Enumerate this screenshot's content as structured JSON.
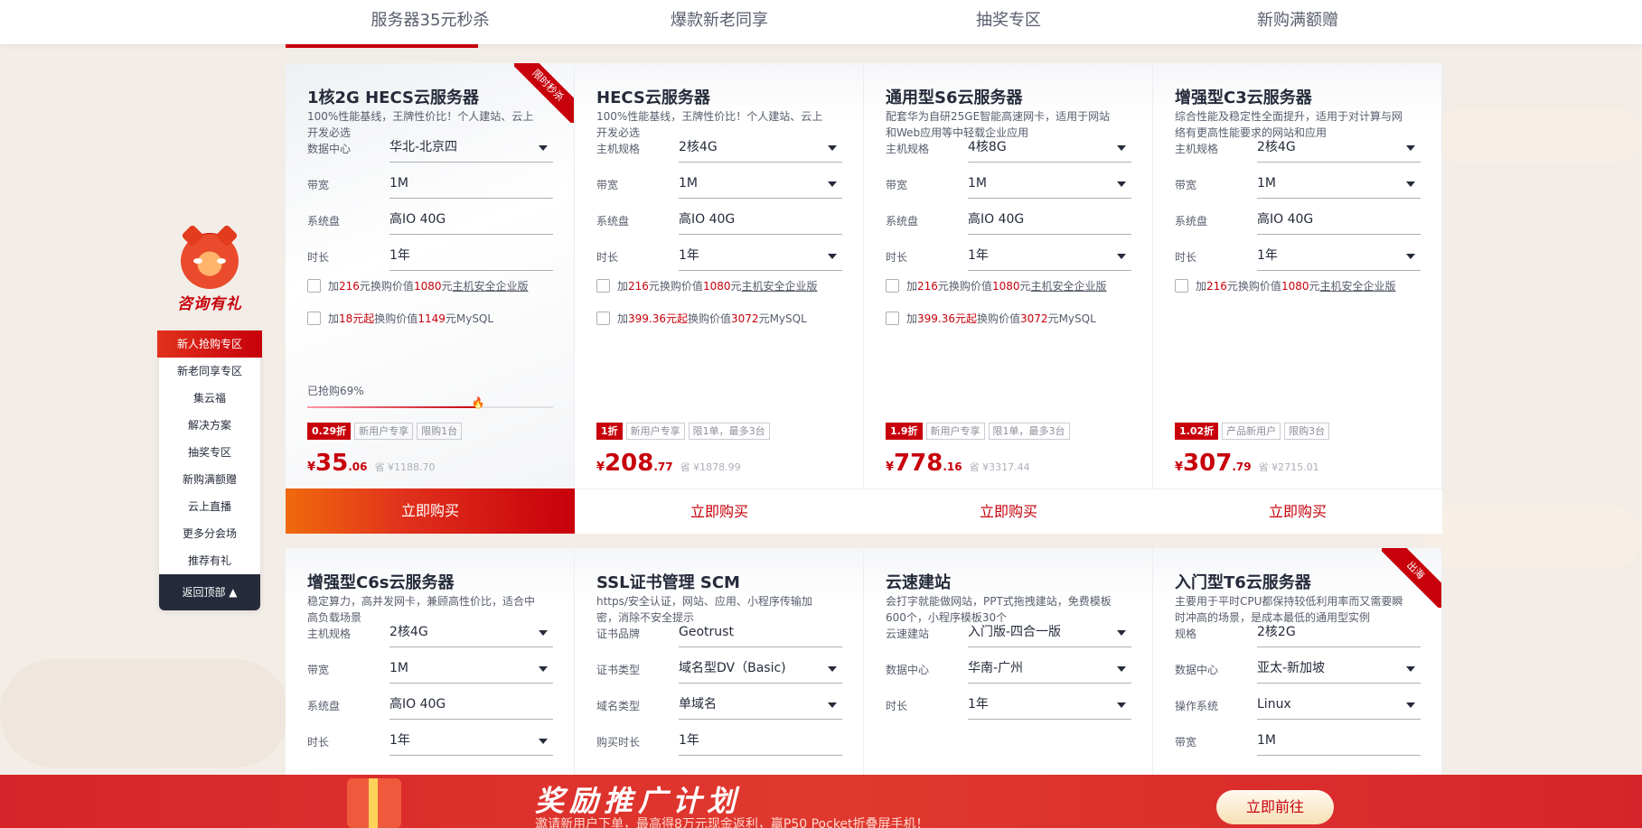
{
  "tabs": [
    "服务器35元秒杀",
    "爆款新老同享",
    "抽奖专区",
    "新购满额赠"
  ],
  "side": {
    "mascot_title": "咨询有礼",
    "items": [
      "新人抢购专区",
      "新老同享专区",
      "集云福",
      "解决方案",
      "抽奖专区",
      "新购满额赠",
      "云上直播",
      "更多分会场",
      "推荐有礼"
    ],
    "back_top": "返回顶部"
  },
  "cards_row1": [
    {
      "ribbon": "限时秒杀",
      "title": "1核2G HECS云服务器",
      "desc": "100%性能基线，王牌性价比！个人建站、云上开发必选",
      "fields": [
        {
          "label": "数据中心",
          "value": "华北-北京四",
          "dropdown": true
        },
        {
          "label": "带宽",
          "value": "1M",
          "dropdown": false
        },
        {
          "label": "系统盘",
          "value": "高IO 40G",
          "dropdown": false
        },
        {
          "label": "时长",
          "value": "1年",
          "dropdown": false
        }
      ],
      "addons": [
        {
          "pre": "加",
          "amt": "216",
          "mid": "元换购价值",
          "val": "1080",
          "post": "元",
          "link": "主机安全企业版"
        },
        {
          "pre": "加",
          "amt": "18元起",
          "mid": "换购价值",
          "val": "1149",
          "post": "元MySQL",
          "link": ""
        }
      ],
      "sold": "已抢购69%",
      "sold_pct": 69,
      "discount": "0.29折",
      "tags": [
        "新用户专享",
        "限购1台"
      ],
      "price_int": "35",
      "price_dec": ".06",
      "orig": "省 ¥1188.70",
      "buy": "立即购买"
    },
    {
      "ribbon": "",
      "title": "HECS云服务器",
      "desc": "100%性能基线，王牌性价比！个人建站、云上开发必选",
      "fields": [
        {
          "label": "主机规格",
          "value": "2核4G",
          "dropdown": true
        },
        {
          "label": "带宽",
          "value": "1M",
          "dropdown": true
        },
        {
          "label": "系统盘",
          "value": "高IO 40G",
          "dropdown": false
        },
        {
          "label": "时长",
          "value": "1年",
          "dropdown": true
        }
      ],
      "addons": [
        {
          "pre": "加",
          "amt": "216",
          "mid": "元换购价值",
          "val": "1080",
          "post": "元",
          "link": "主机安全企业版"
        },
        {
          "pre": "加",
          "amt": "399.36元起",
          "mid": "换购价值",
          "val": "3072",
          "post": "元MySQL",
          "link": ""
        }
      ],
      "discount": "1折",
      "tags": [
        "新用户专享",
        "限1单，最多3台"
      ],
      "price_int": "208",
      "price_dec": ".77",
      "orig": "省 ¥1878.99",
      "buy": "立即购买"
    },
    {
      "ribbon": "",
      "title": "通用型S6云服务器",
      "desc": "配套华为自研25GE智能高速网卡，适用于网站和Web应用等中轻载企业应用",
      "fields": [
        {
          "label": "主机规格",
          "value": "4核8G",
          "dropdown": true
        },
        {
          "label": "带宽",
          "value": "1M",
          "dropdown": true
        },
        {
          "label": "系统盘",
          "value": "高IO 40G",
          "dropdown": false
        },
        {
          "label": "时长",
          "value": "1年",
          "dropdown": true
        }
      ],
      "addons": [
        {
          "pre": "加",
          "amt": "216",
          "mid": "元换购价值",
          "val": "1080",
          "post": "元",
          "link": "主机安全企业版"
        },
        {
          "pre": "加",
          "amt": "399.36元起",
          "mid": "换购价值",
          "val": "3072",
          "post": "元MySQL",
          "link": ""
        }
      ],
      "discount": "1.9折",
      "tags": [
        "新用户专享",
        "限1单，最多3台"
      ],
      "price_int": "778",
      "price_dec": ".16",
      "orig": "省 ¥3317.44",
      "buy": "立即购买"
    },
    {
      "ribbon": "",
      "title": "增强型C3云服务器",
      "desc": "综合性能及稳定性全面提升，适用于对计算与网络有更高性能要求的网站和应用",
      "fields": [
        {
          "label": "主机规格",
          "value": "2核4G",
          "dropdown": true
        },
        {
          "label": "带宽",
          "value": "1M",
          "dropdown": true
        },
        {
          "label": "系统盘",
          "value": "高IO 40G",
          "dropdown": false
        },
        {
          "label": "时长",
          "value": "1年",
          "dropdown": true
        }
      ],
      "addons": [
        {
          "pre": "加",
          "amt": "216",
          "mid": "元换购价值",
          "val": "1080",
          "post": "元",
          "link": "主机安全企业版"
        }
      ],
      "discount": "1.02折",
      "tags": [
        "产品新用户",
        "限购3台"
      ],
      "price_int": "307",
      "price_dec": ".79",
      "orig": "省 ¥2715.01",
      "buy": "立即购买"
    }
  ],
  "cards_row2": [
    {
      "ribbon": "",
      "title": "增强型C6s云服务器",
      "desc": "稳定算力，高并发网卡，兼顾高性价比，适合中高负载场景",
      "fields": [
        {
          "label": "主机规格",
          "value": "2核4G",
          "dropdown": true
        },
        {
          "label": "带宽",
          "value": "1M",
          "dropdown": true
        },
        {
          "label": "系统盘",
          "value": "高IO 40G",
          "dropdown": false
        },
        {
          "label": "时长",
          "value": "1年",
          "dropdown": true
        }
      ]
    },
    {
      "ribbon": "",
      "title": "SSL证书管理 SCM",
      "desc": "https/安全认证，网站、应用、小程序传输加密，消除不安全提示",
      "fields": [
        {
          "label": "证书品牌",
          "value": "Geotrust",
          "dropdown": false
        },
        {
          "label": "证书类型",
          "value": "域名型DV（Basic)",
          "dropdown": true
        },
        {
          "label": "域名类型",
          "value": "单域名",
          "dropdown": true
        },
        {
          "label": "购买时长",
          "value": "1年",
          "dropdown": false
        }
      ]
    },
    {
      "ribbon": "",
      "title": "云速建站",
      "desc": "会打字就能做网站，PPT式拖拽建站，免费模板600个，小程序模板30个",
      "fields": [
        {
          "label": "云速建站",
          "value": "入门版-四合一版",
          "dropdown": true
        },
        {
          "label": "数据中心",
          "value": "华南-广州",
          "dropdown": true
        },
        {
          "label": "时长",
          "value": "1年",
          "dropdown": true
        }
      ]
    },
    {
      "ribbon": "出海",
      "title": "入门型T6云服务器",
      "desc": "主要用于平时CPU都保持较低利用率而又需要瞬时冲高的场景，是成本最低的通用型实例",
      "fields": [
        {
          "label": "规格",
          "value": "2核2G",
          "dropdown": false
        },
        {
          "label": "数据中心",
          "value": "亚太-新加坡",
          "dropdown": true
        },
        {
          "label": "操作系统",
          "value": "Linux",
          "dropdown": true
        },
        {
          "label": "带宽",
          "value": "1M",
          "dropdown": false
        }
      ]
    }
  ],
  "banner": {
    "title": "奖励推广计划",
    "sub": "邀请新用户下单，最高得8万元现金返利，赢P50 Pocket折叠屏手机！",
    "button": "立即前往"
  },
  "colors": {
    "brand": "#c7000b",
    "dark": "#252b3a"
  }
}
